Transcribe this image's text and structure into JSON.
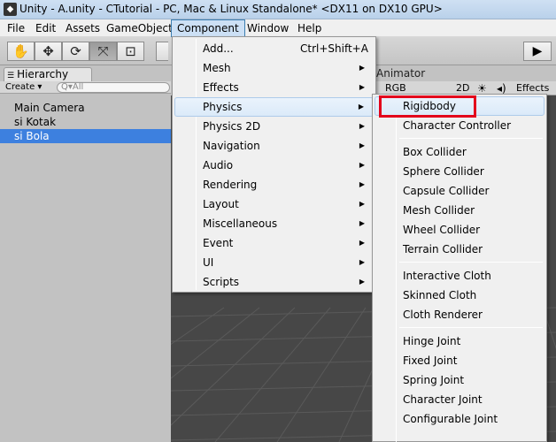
{
  "window": {
    "title": "Unity - A.unity - CTutorial - PC, Mac & Linux Standalone* <DX11 on DX10 GPU>"
  },
  "menubar": {
    "items": [
      "File",
      "Edit",
      "Assets",
      "GameObject",
      "Component",
      "Window",
      "Help"
    ],
    "active": "Component"
  },
  "toolbar": {
    "tools": [
      {
        "name": "hand-icon",
        "glyph": "✋"
      },
      {
        "name": "move-icon",
        "glyph": "✥"
      },
      {
        "name": "rotate-icon",
        "glyph": "⟳"
      },
      {
        "name": "scale-icon",
        "glyph": "⤧"
      },
      {
        "name": "rect-icon",
        "glyph": "⊡"
      }
    ],
    "play_glyph": "▶"
  },
  "hierarchy": {
    "tab_label": "Hierarchy",
    "create_label": "Create ▾",
    "search_placeholder": "Q▾All",
    "items": [
      {
        "label": "Main Camera",
        "selected": false
      },
      {
        "label": "si Kotak",
        "selected": false
      },
      {
        "label": "si Bola",
        "selected": true
      }
    ]
  },
  "scene": {
    "animator_tab": "Animator",
    "rgb_label": "RGB",
    "btn_2d": "2D",
    "sun_glyph": "☀",
    "audio_glyph": "◂)",
    "effects_label": "Effects"
  },
  "component_menu": {
    "items": [
      {
        "label": "Add...",
        "shortcut": "Ctrl+Shift+A",
        "submenu": false
      },
      {
        "label": "Mesh",
        "submenu": true
      },
      {
        "label": "Effects",
        "submenu": true
      },
      {
        "label": "Physics",
        "submenu": true,
        "hover": true
      },
      {
        "label": "Physics 2D",
        "submenu": true
      },
      {
        "label": "Navigation",
        "submenu": true
      },
      {
        "label": "Audio",
        "submenu": true
      },
      {
        "label": "Rendering",
        "submenu": true
      },
      {
        "label": "Layout",
        "submenu": true
      },
      {
        "label": "Miscellaneous",
        "submenu": true
      },
      {
        "label": "Event",
        "submenu": true
      },
      {
        "label": "UI",
        "submenu": true
      },
      {
        "label": "Scripts",
        "submenu": true
      }
    ],
    "arrow_glyph": "▶"
  },
  "physics_menu": {
    "groups": [
      [
        "Rigidbody",
        "Character Controller"
      ],
      [
        "Box Collider",
        "Sphere Collider",
        "Capsule Collider",
        "Mesh Collider",
        "Wheel Collider",
        "Terrain Collider"
      ],
      [
        "Interactive Cloth",
        "Skinned Cloth",
        "Cloth Renderer"
      ],
      [
        "Hinge Joint",
        "Fixed Joint",
        "Spring Joint",
        "Character Joint",
        "Configurable Joint"
      ]
    ],
    "highlighted": "Rigidbody",
    "highlight_color": "#e3001b"
  }
}
